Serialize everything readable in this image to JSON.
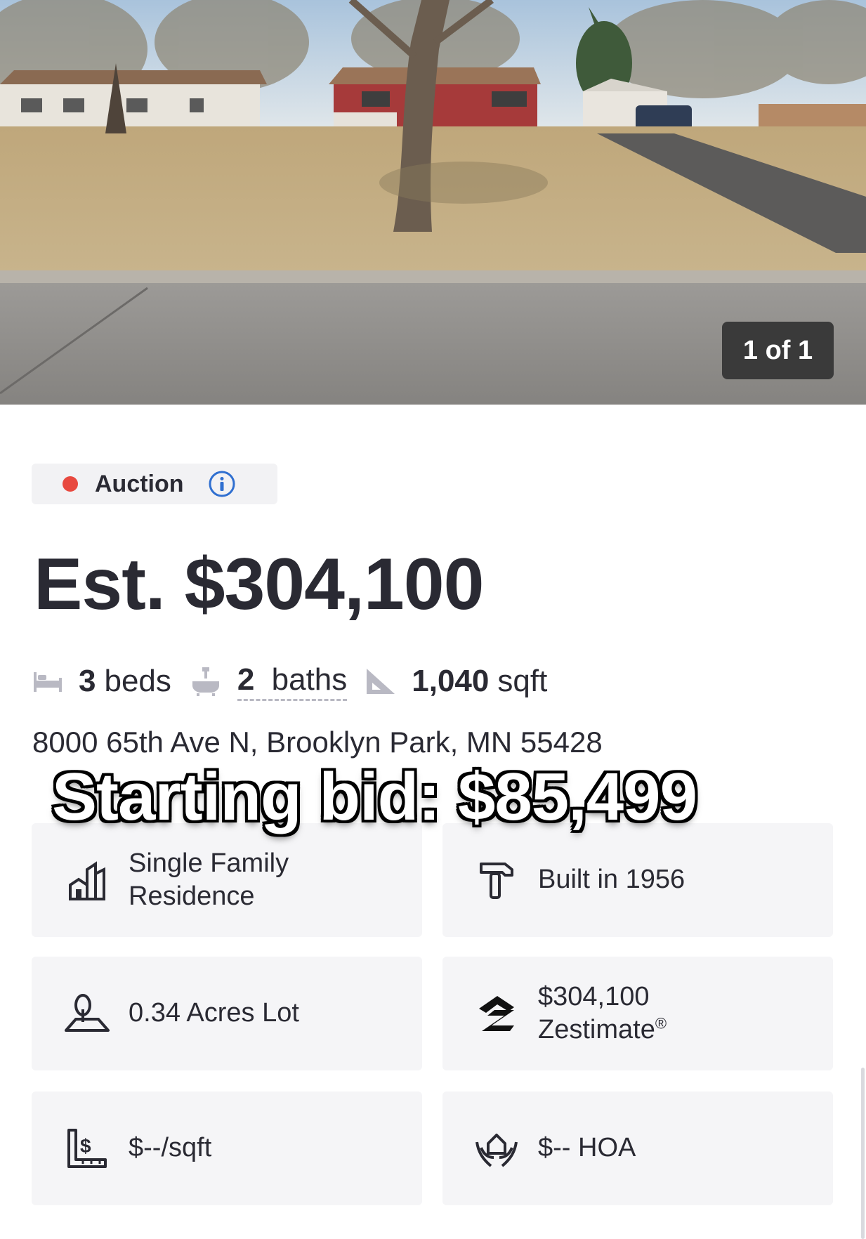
{
  "photo": {
    "counter": "1 of 1",
    "subject": "house-exterior-photo"
  },
  "status": {
    "label": "Auction",
    "dot_color": "#e8493f",
    "info_icon": "info-icon"
  },
  "price": "Est. $304,100",
  "facts": {
    "beds_num": "3",
    "beds_unit": "beds",
    "baths_num": "2",
    "baths_unit": "baths",
    "sqft_num": "1,040",
    "sqft_unit": "sqft"
  },
  "address": "8000 65th Ave N, Brooklyn Park, MN 55428",
  "overlay_caption": "Starting bid: $85,499",
  "cards": {
    "home_type_line1": "Single Family",
    "home_type_line2": "Residence",
    "year_built": "Built in 1956",
    "lot": "0.34 Acres Lot",
    "zestimate_value": "$304,100",
    "zestimate_label": "Zestimate",
    "zestimate_mark": "®",
    "price_per_sqft": "$--/sqft",
    "hoa": "$-- HOA"
  }
}
